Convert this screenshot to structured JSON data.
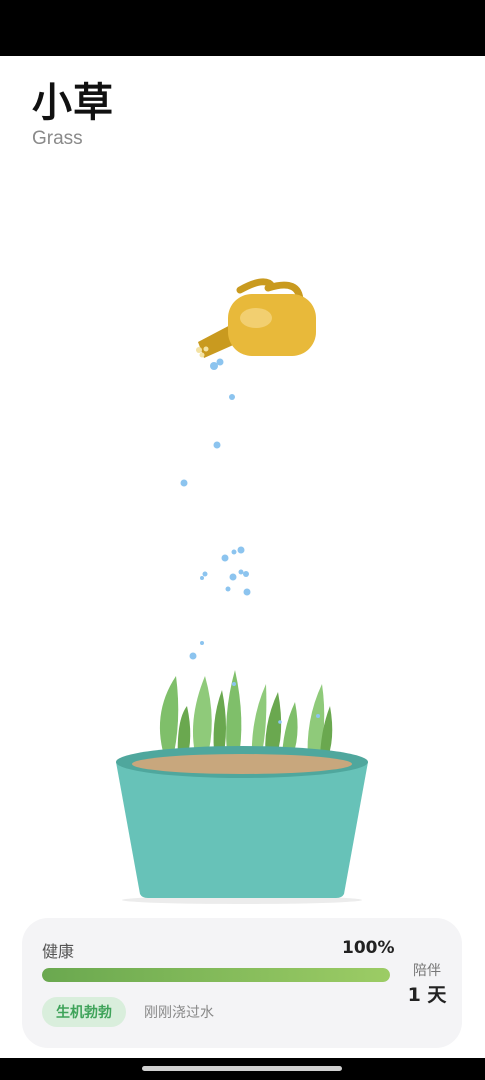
{
  "header": {
    "title": "小草",
    "subtitle": "Grass"
  },
  "scene": {
    "icons": [
      "watering-can-icon",
      "water-drop-icon",
      "grass-icon",
      "plant-pot-icon"
    ],
    "colors": {
      "pot": "#67c2b8",
      "soil": "#c8a77d",
      "grass": "#7fbf6a",
      "can": "#e8b93a",
      "water": "#8cc4ef"
    }
  },
  "status_card": {
    "health_label": "健康",
    "health_value": "100%",
    "health_level": 1.0,
    "state_badge": "生机勃勃",
    "water_note": "刚刚浇过水",
    "companion_label": "陪伴",
    "companion_value": "1 天"
  }
}
